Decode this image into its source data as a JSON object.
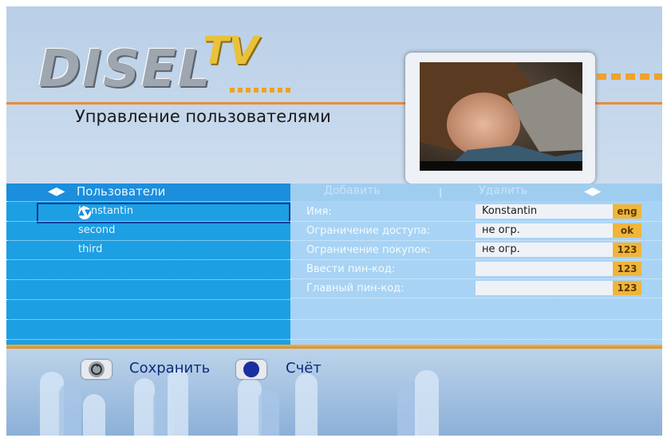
{
  "logo": {
    "brand": "DISEL",
    "suffix": "TV"
  },
  "page_title": "Управление пользователями",
  "users_panel": {
    "title": "Пользователи",
    "users": [
      "Konstantin",
      "second",
      "third"
    ],
    "selected_index": 0
  },
  "actions": {
    "add": "Добавить",
    "delete": "Удалить",
    "separator": "|"
  },
  "fields": [
    {
      "label": "Имя:",
      "value": "Konstantin",
      "badge": "eng"
    },
    {
      "label": "Ограничение доступа:",
      "value": "не огр.",
      "badge": "ok"
    },
    {
      "label": "Ограничение покупок:",
      "value": "не огр.",
      "badge": "123"
    },
    {
      "label": "Ввести пин-код:",
      "value": "",
      "badge": "123"
    },
    {
      "label": "Главный пин-код:",
      "value": "",
      "badge": "123"
    }
  ],
  "footer": {
    "save_label": "Сохранить",
    "account_label": "Счёт"
  },
  "colors": {
    "list_bg": "#1d9fe3",
    "detail_bg": "#a8d3f4",
    "badge": "#f0b53a",
    "accent_line": "#e98c3b"
  },
  "icons": {
    "left_arrows": "◀▶",
    "right_arrows": "◀▶",
    "updown": "▲▼",
    "save_button_icon": "refresh-icon",
    "account_button_icon": "blue-dot-icon"
  }
}
